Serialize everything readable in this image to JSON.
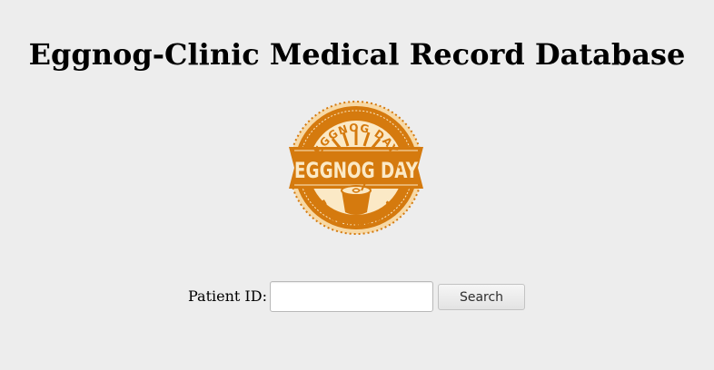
{
  "page": {
    "title": "Eggnog-Clinic Medical Record Database"
  },
  "logo": {
    "top_text": "EGGNOG DAY",
    "main_text": "EGGNOG DAY",
    "bottom_text": "DECEMBER 24",
    "colors": {
      "primary": "#d57a0e",
      "light": "#f7d9a6",
      "inner": "#fbe9c6"
    }
  },
  "search": {
    "label": "Patient ID:",
    "input_value": "",
    "input_placeholder": "",
    "button_label": "Search"
  }
}
